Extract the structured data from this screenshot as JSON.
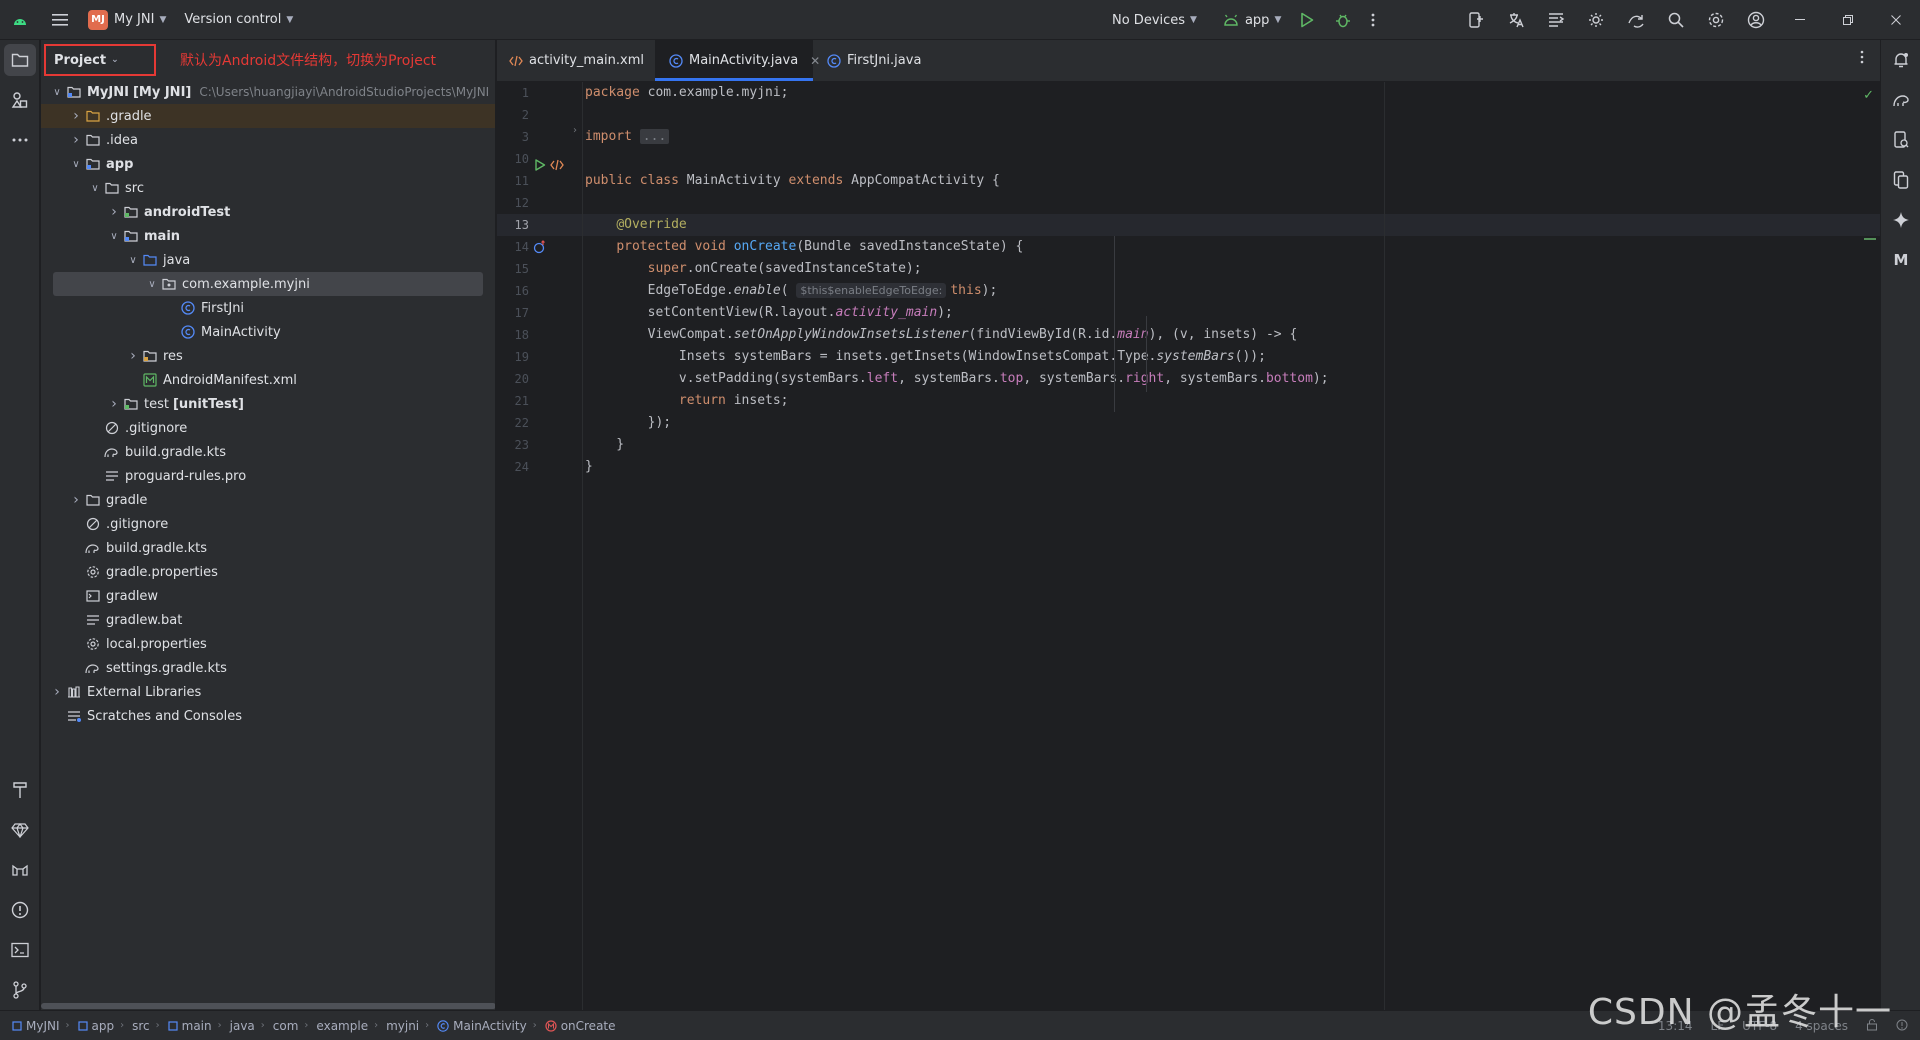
{
  "titlebar": {
    "project_badge": "MJ",
    "project_name": "My JNI",
    "version_control": "Version control",
    "device": "No Devices",
    "run_config": "app"
  },
  "project_panel": {
    "dropdown_label": "Project",
    "annotation": "默认为Android文件结构，切换为Project",
    "tree": [
      {
        "label": "MyJNI",
        "suffix": "[My JNI]",
        "hint": "C:\\Users\\huangjiayi\\AndroidStudioProjects\\MyJNI",
        "indent": 0,
        "chevron": "down",
        "icon": "module",
        "bold": true
      },
      {
        "label": ".gradle",
        "indent": 1,
        "chevron": "right",
        "icon": "folder-orange",
        "highlight": true
      },
      {
        "label": ".idea",
        "indent": 1,
        "chevron": "right",
        "icon": "folder"
      },
      {
        "label": "app",
        "indent": 1,
        "chevron": "down",
        "icon": "module-folder",
        "bold": true
      },
      {
        "label": "src",
        "indent": 2,
        "chevron": "down",
        "icon": "folder"
      },
      {
        "label": "androidTest",
        "indent": 3,
        "chevron": "right",
        "icon": "folder-test",
        "bold": true
      },
      {
        "label": "main",
        "indent": 3,
        "chevron": "down",
        "icon": "folder-src",
        "bold": true
      },
      {
        "label": "java",
        "indent": 4,
        "chevron": "down",
        "icon": "folder-blue"
      },
      {
        "label": "com.example.myjni",
        "indent": 5,
        "chevron": "down",
        "icon": "package",
        "selected": true
      },
      {
        "label": "FirstJni",
        "indent": 6,
        "chevron": "",
        "icon": "class"
      },
      {
        "label": "MainActivity",
        "indent": 6,
        "chevron": "",
        "icon": "class"
      },
      {
        "label": "res",
        "indent": 4,
        "chevron": "right",
        "icon": "folder-res"
      },
      {
        "label": "AndroidManifest.xml",
        "indent": 4,
        "chevron": "",
        "icon": "manifest"
      },
      {
        "label": "test",
        "suffix": "[unitTest]",
        "indent": 3,
        "chevron": "right",
        "icon": "folder-test"
      },
      {
        "label": ".gitignore",
        "indent": 2,
        "chevron": "",
        "icon": "ignore"
      },
      {
        "label": "build.gradle.kts",
        "indent": 2,
        "chevron": "",
        "icon": "gradle"
      },
      {
        "label": "proguard-rules.pro",
        "indent": 2,
        "chevron": "",
        "icon": "text"
      },
      {
        "label": "gradle",
        "indent": 1,
        "chevron": "right",
        "icon": "folder"
      },
      {
        "label": ".gitignore",
        "indent": 1,
        "chevron": "",
        "icon": "ignore"
      },
      {
        "label": "build.gradle.kts",
        "indent": 1,
        "chevron": "",
        "icon": "gradle"
      },
      {
        "label": "gradle.properties",
        "indent": 1,
        "chevron": "",
        "icon": "settings"
      },
      {
        "label": "gradlew",
        "indent": 1,
        "chevron": "",
        "icon": "terminal"
      },
      {
        "label": "gradlew.bat",
        "indent": 1,
        "chevron": "",
        "icon": "text"
      },
      {
        "label": "local.properties",
        "indent": 1,
        "chevron": "",
        "icon": "settings"
      },
      {
        "label": "settings.gradle.kts",
        "indent": 1,
        "chevron": "",
        "icon": "gradle"
      },
      {
        "label": "External Libraries",
        "indent": 0,
        "chevron": "right",
        "icon": "library"
      },
      {
        "label": "Scratches and Consoles",
        "indent": 0,
        "chevron": "",
        "icon": "scratch"
      }
    ]
  },
  "tabs": [
    {
      "label": "activity_main.xml",
      "icon": "xml",
      "active": false
    },
    {
      "label": "MainActivity.java",
      "icon": "class",
      "active": true
    },
    {
      "label": "FirstJni.java",
      "icon": "class",
      "active": false
    }
  ],
  "editor": {
    "current_line": 13,
    "lines": [
      {
        "n": 1,
        "html": "<span class=\"kw\">package</span> com.example.myjni;"
      },
      {
        "n": 2,
        "html": ""
      },
      {
        "n": 3,
        "html": "<span class=\"kw\">import</span> <span class=\"fold\">...</span>"
      },
      {
        "n": 10,
        "html": ""
      },
      {
        "n": 11,
        "html": "<span class=\"kw\">public class</span> MainActivity <span class=\"kw\">extends</span> AppCompatActivity {"
      },
      {
        "n": 12,
        "html": ""
      },
      {
        "n": 13,
        "html": "    <span class=\"ann\">@Override</span>"
      },
      {
        "n": 14,
        "html": "    <span class=\"kw\">protected void</span> <span class=\"fn\">onCreate</span>(Bundle savedInstanceState) {"
      },
      {
        "n": 15,
        "html": "        <span class=\"kw\">super</span>.onCreate(savedInstanceState);"
      },
      {
        "n": 16,
        "html": "        EdgeToEdge.<span class=\"it\">enable</span>( <span class=\"hint\">$this$enableEdgeToEdge:</span><span class=\"kw\">this</span>);"
      },
      {
        "n": 17,
        "html": "        setContentView(R.layout.<span class=\"fldi\">activity_main</span>);"
      },
      {
        "n": 18,
        "html": "        ViewCompat.<span class=\"it\">setOnApplyWindowInsetsListener</span>(findViewById(R.id.<span class=\"fldi\">main</span>), (v, insets) -&gt; {"
      },
      {
        "n": 19,
        "html": "            Insets systemBars = insets.getInsets(WindowInsetsCompat.Type.<span class=\"it\">systemBars</span>());"
      },
      {
        "n": 20,
        "html": "            v.setPadding(systemBars.<span class=\"fld\">left</span>, systemBars.<span class=\"fld\">top</span>, systemBars.<span class=\"fld\">right</span>, systemBars.<span class=\"fld\">bottom</span>);"
      },
      {
        "n": 21,
        "html": "            <span class=\"kw\">return</span> insets;"
      },
      {
        "n": 22,
        "html": "        });"
      },
      {
        "n": 23,
        "html": "    }"
      },
      {
        "n": 24,
        "html": "}"
      }
    ]
  },
  "statusbar": {
    "breadcrumbs": [
      {
        "label": "MyJNI",
        "icon": "module"
      },
      {
        "label": "app",
        "icon": "module"
      },
      {
        "label": "src",
        "icon": ""
      },
      {
        "label": "main",
        "icon": "module"
      },
      {
        "label": "java",
        "icon": ""
      },
      {
        "label": "com",
        "icon": ""
      },
      {
        "label": "example",
        "icon": ""
      },
      {
        "label": "myjni",
        "icon": ""
      },
      {
        "label": "MainActivity",
        "icon": "class"
      },
      {
        "label": "onCreate",
        "icon": "method"
      }
    ],
    "position": "13:14",
    "line_sep": "LF",
    "encoding": "UTF-8",
    "indent": "4 spaces"
  },
  "watermark": "CSDN @孟冬十一",
  "colors": {
    "accent": "#3574f0",
    "annotation_red": "#e53935",
    "run_green": "#5fb865"
  }
}
